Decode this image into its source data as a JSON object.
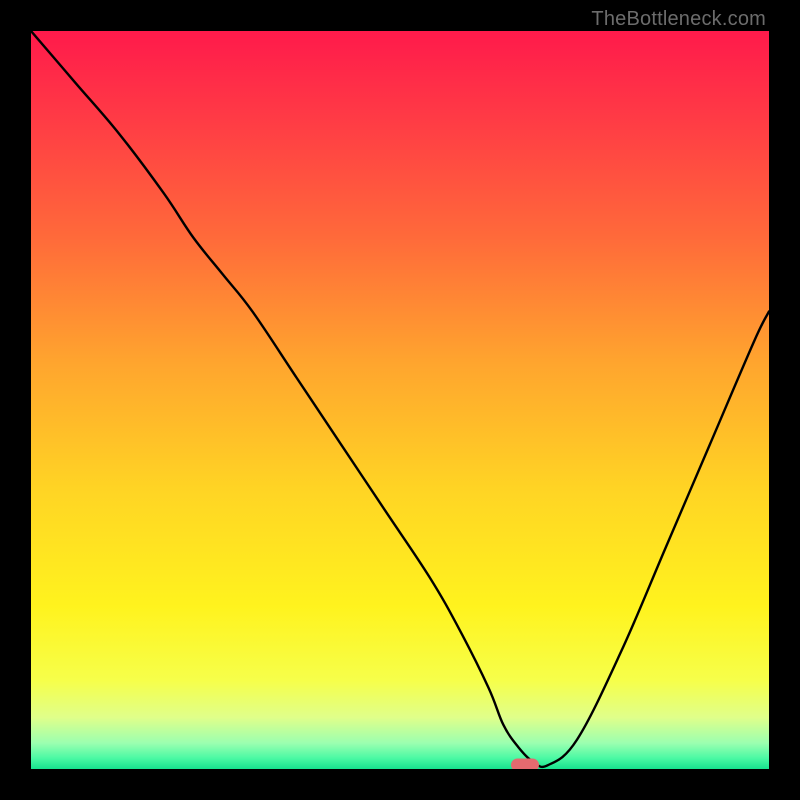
{
  "watermark": "TheBottleneck.com",
  "colors": {
    "background": "#000000",
    "marker": "#e46a6f",
    "curve": "#000000"
  },
  "chart_data": {
    "type": "line",
    "title": "",
    "xlabel": "",
    "ylabel": "",
    "xlim": [
      0,
      100
    ],
    "ylim": [
      0,
      100
    ],
    "gradient_stops": [
      {
        "offset": 0,
        "color": "#ff1a4b"
      },
      {
        "offset": 0.12,
        "color": "#ff3b45"
      },
      {
        "offset": 0.28,
        "color": "#ff6a3a"
      },
      {
        "offset": 0.45,
        "color": "#ffa52e"
      },
      {
        "offset": 0.62,
        "color": "#ffd424"
      },
      {
        "offset": 0.78,
        "color": "#fff31e"
      },
      {
        "offset": 0.88,
        "color": "#f6ff4a"
      },
      {
        "offset": 0.93,
        "color": "#e0ff8a"
      },
      {
        "offset": 0.965,
        "color": "#9bffb0"
      },
      {
        "offset": 0.985,
        "color": "#4cf9a4"
      },
      {
        "offset": 1.0,
        "color": "#17e28e"
      }
    ],
    "series": [
      {
        "name": "bottleneck-curve",
        "x": [
          0,
          6,
          12,
          18,
          22,
          26,
          30,
          36,
          42,
          48,
          54,
          58,
          62,
          64,
          66,
          68,
          70,
          74,
          80,
          86,
          92,
          98,
          100
        ],
        "y": [
          100,
          93,
          86,
          78,
          72,
          67,
          62,
          53,
          44,
          35,
          26,
          19,
          11,
          6,
          3,
          1,
          0.5,
          4,
          16,
          30,
          44,
          58,
          62
        ]
      }
    ],
    "marker": {
      "x": 67,
      "y": 0.5
    }
  }
}
